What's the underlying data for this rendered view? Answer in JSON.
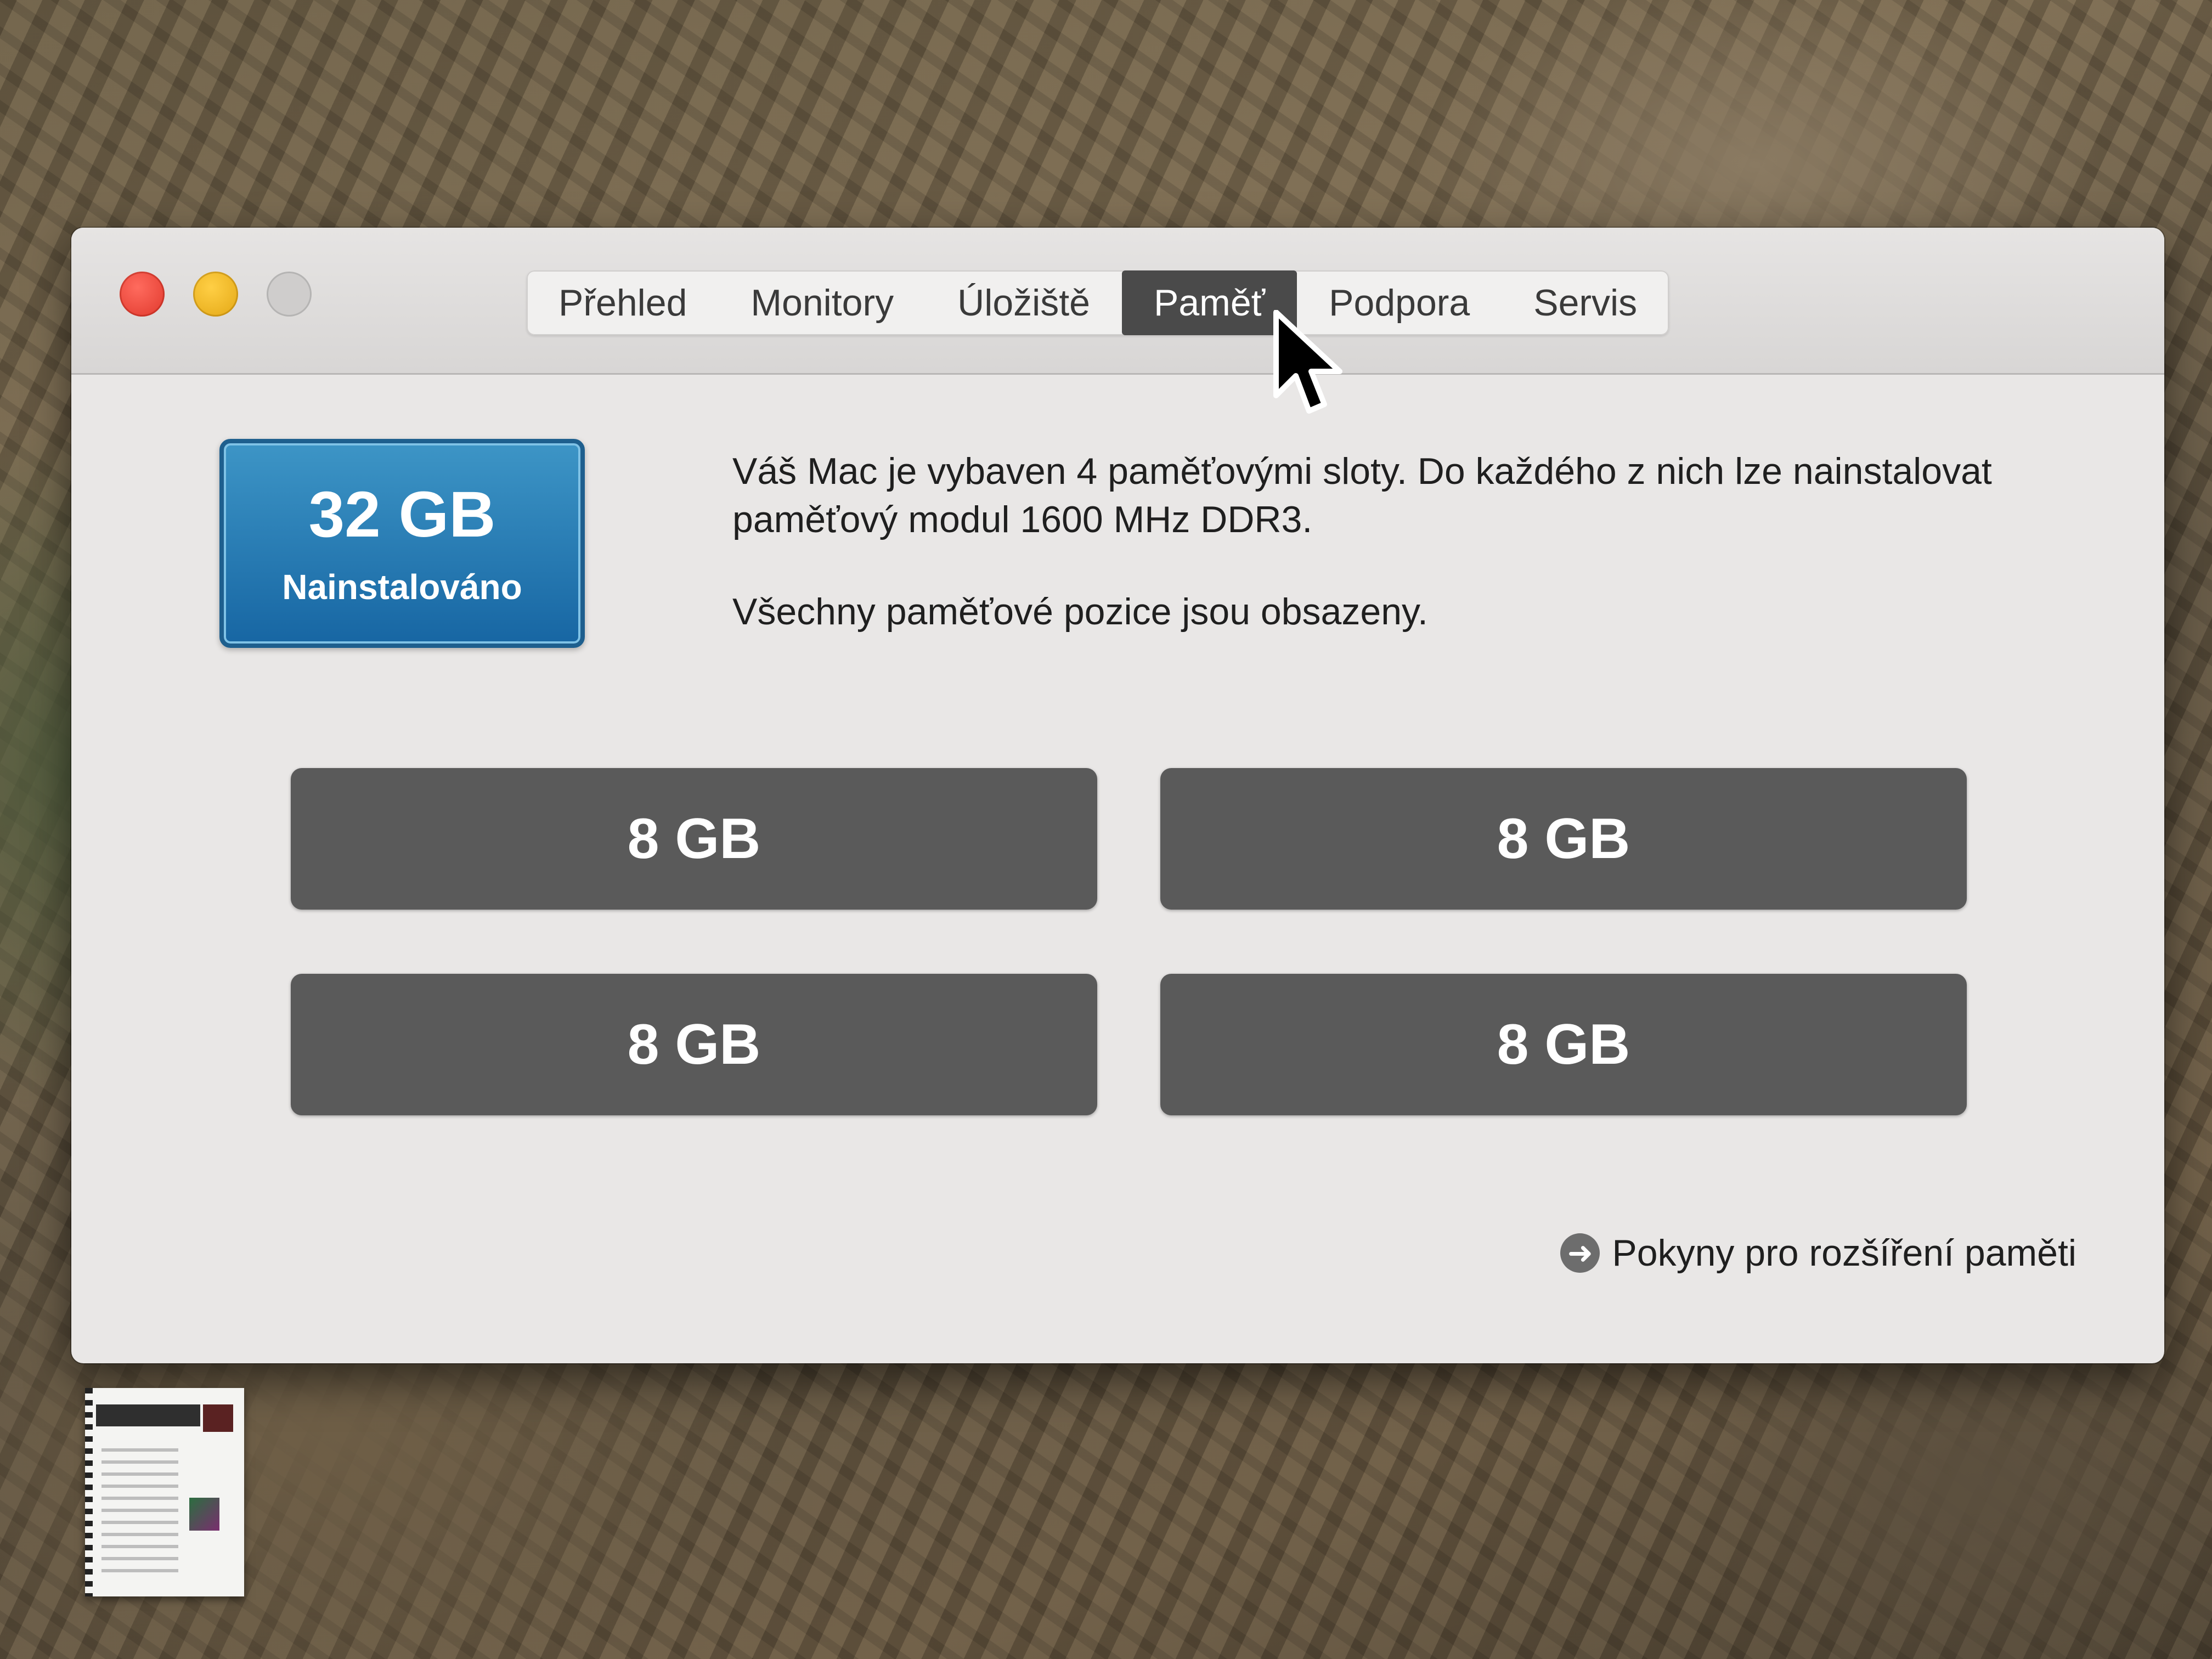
{
  "window": {
    "tabs": [
      {
        "label": "Přehled"
      },
      {
        "label": "Monitory"
      },
      {
        "label": "Úložiště"
      },
      {
        "label": "Paměť",
        "active": true
      },
      {
        "label": "Podpora"
      },
      {
        "label": "Servis"
      }
    ]
  },
  "memory": {
    "total": "32 GB",
    "total_label": "Nainstalováno",
    "description": "Váš Mac je vybaven 4 paměťovými sloty. Do každého z nich lze nainstalovat paměťový modul 1600 MHz DDR3.",
    "status": "Všechny paměťové pozice jsou obsazeny.",
    "slots": [
      {
        "size": "8 GB"
      },
      {
        "size": "8 GB"
      },
      {
        "size": "8 GB"
      },
      {
        "size": "8 GB"
      }
    ],
    "upgrade_link": "Pokyny pro rozšíření paměti"
  },
  "icons": {
    "link_icon": "arrow-right-circle-icon",
    "cursor": "pointer-cursor-icon",
    "desktop_item": "document-icon"
  },
  "colors": {
    "badge": "#1f74ad",
    "slot": "#5a5a5a",
    "active_tab": "#4a4a4a"
  }
}
